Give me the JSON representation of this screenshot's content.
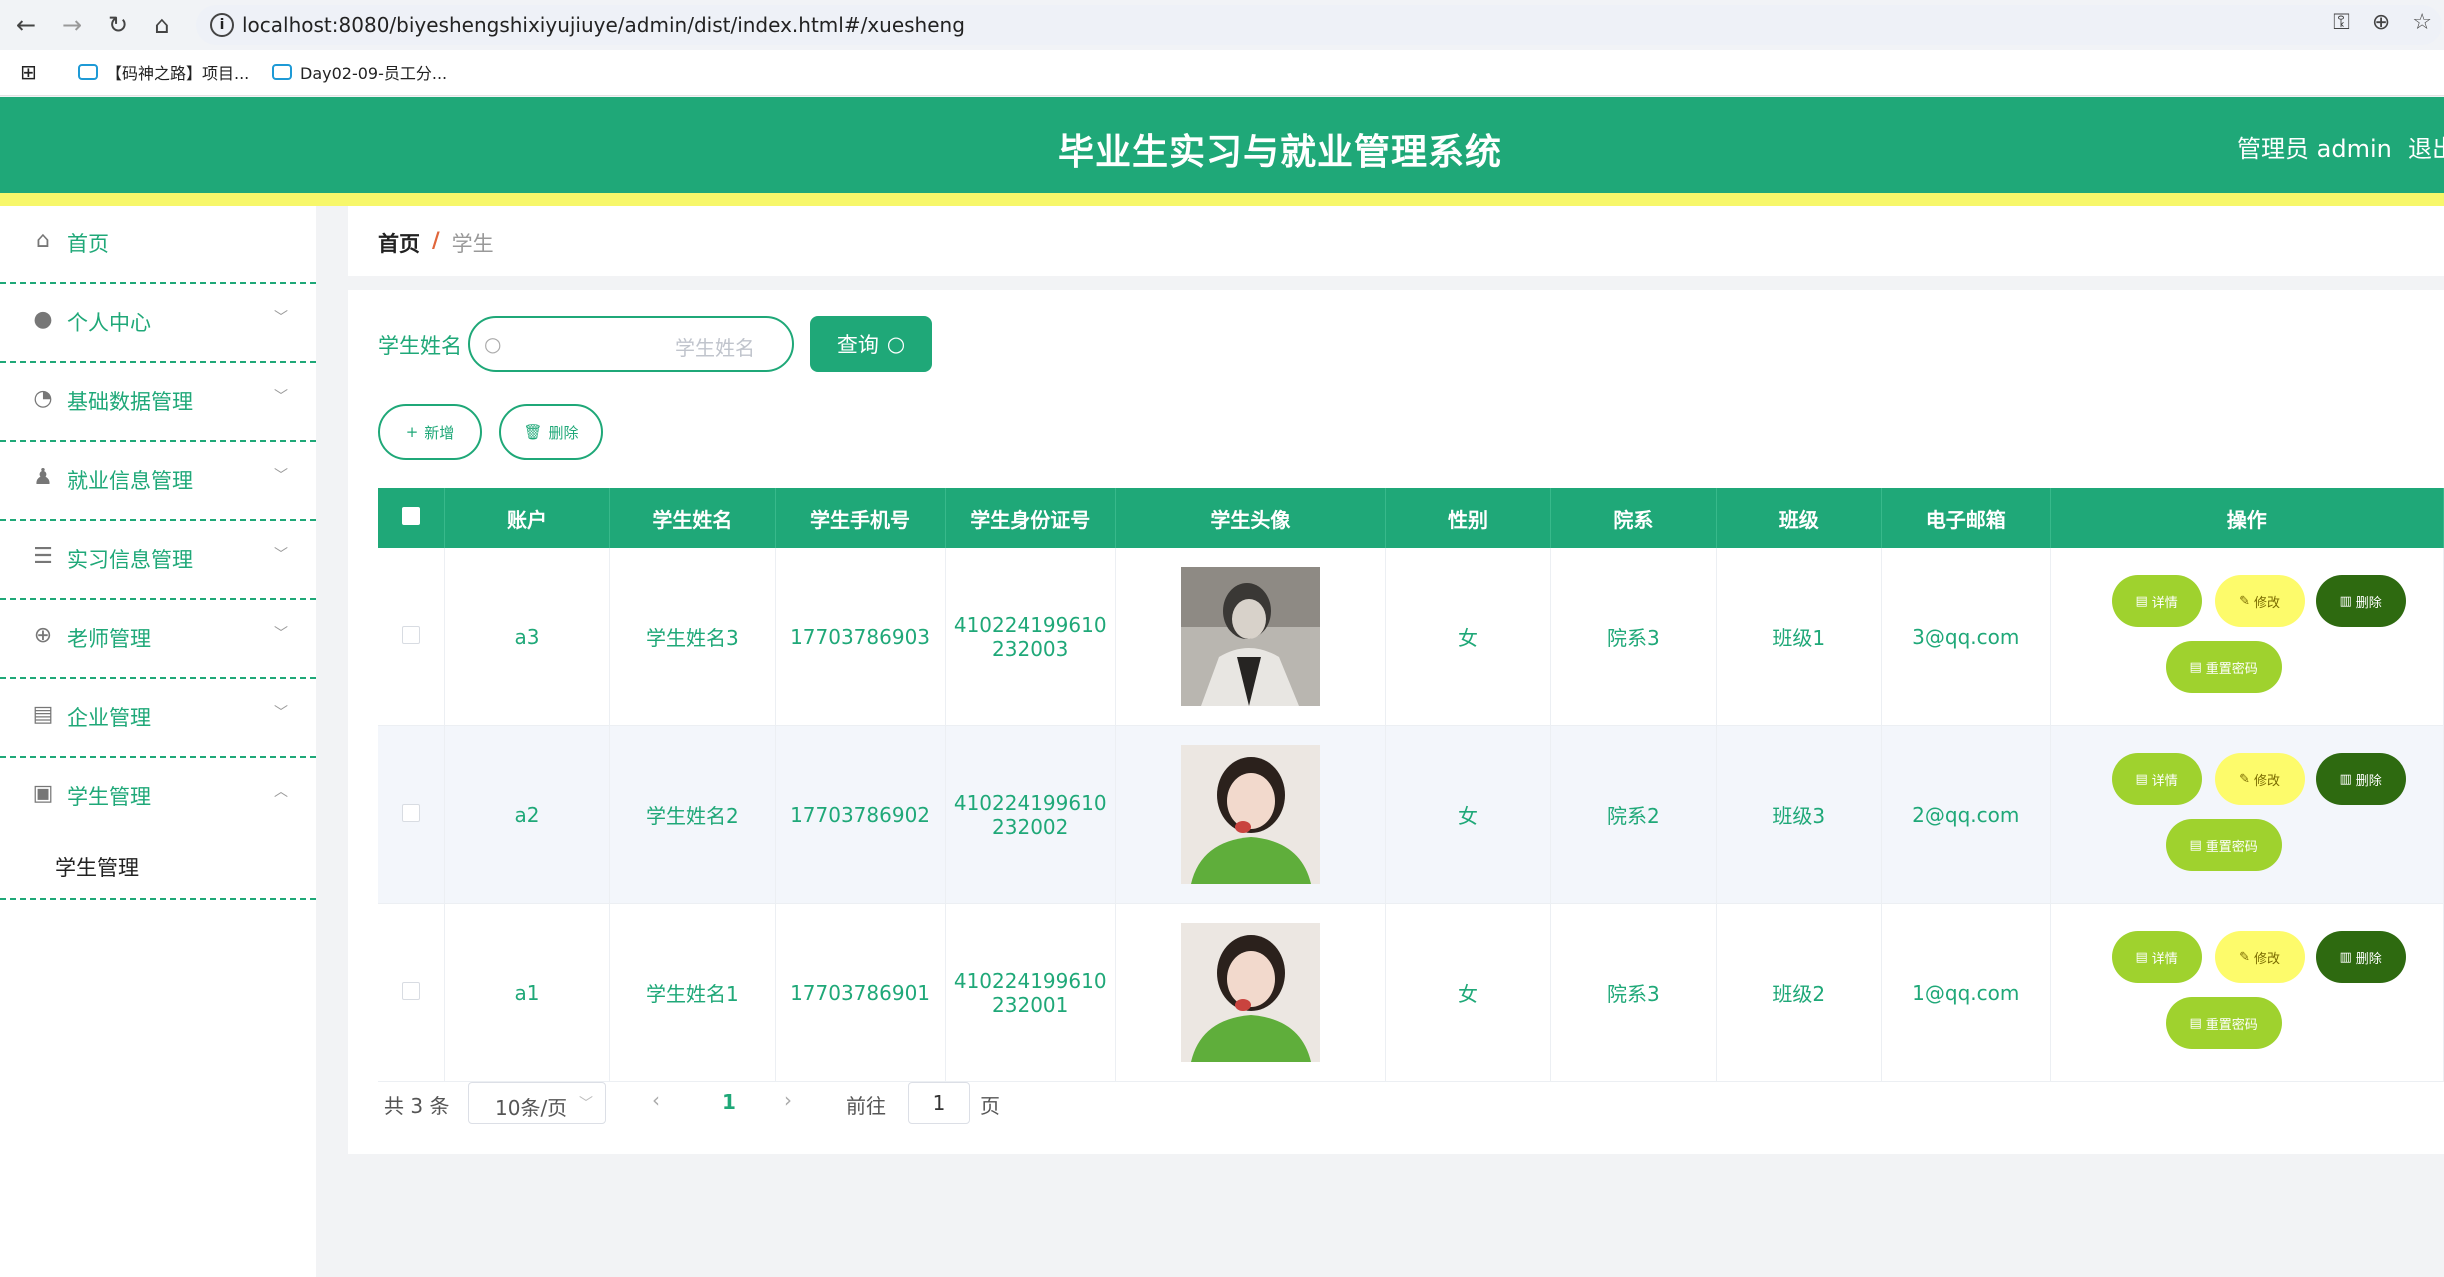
{
  "browser": {
    "url": "localhost:8080/biyeshengshixiyujiuye/admin/dist/index.html#/xuesheng",
    "bookmarks": [
      "【码神之路】项目...",
      "Day02-09-员工分..."
    ]
  },
  "header": {
    "title": "毕业生实习与就业管理系统",
    "user": "管理员 admin",
    "logout": "退出"
  },
  "sidebar": {
    "items": [
      {
        "label": "首页",
        "icon": "home-icon"
      },
      {
        "label": "个人中心",
        "icon": "user-icon"
      },
      {
        "label": "基础数据管理",
        "icon": "gauge-icon"
      },
      {
        "label": "就业信息管理",
        "icon": "stamp-icon"
      },
      {
        "label": "实习信息管理",
        "icon": "sliders-icon"
      },
      {
        "label": "老师管理",
        "icon": "compass-icon"
      },
      {
        "label": "企业管理",
        "icon": "wallet-icon"
      },
      {
        "label": "学生管理",
        "icon": "clipboard-icon"
      }
    ],
    "subitem": "学生管理"
  },
  "breadcrumb": {
    "home": "首页",
    "separator": "/",
    "current": "学生"
  },
  "search": {
    "label": "学生姓名",
    "placeholder": "学生姓名",
    "query_label": "查询"
  },
  "actions": {
    "add_label": "新增",
    "delete_label": "删除"
  },
  "table": {
    "columns": [
      "账户",
      "学生姓名",
      "学生手机号",
      "学生身份证号",
      "学生头像",
      "性别",
      "院系",
      "班级",
      "电子邮箱",
      "操作"
    ],
    "rows": [
      {
        "account": "a3",
        "name": "学生姓名3",
        "phone": "17703786903",
        "id_line1": "410224199610",
        "id_line2": "232003",
        "gender": "女",
        "department": "院系3",
        "class": "班级1",
        "email": "3@qq.com"
      },
      {
        "account": "a2",
        "name": "学生姓名2",
        "phone": "17703786902",
        "id_line1": "410224199610",
        "id_line2": "232002",
        "gender": "女",
        "department": "院系2",
        "class": "班级3",
        "email": "2@qq.com"
      },
      {
        "account": "a1",
        "name": "学生姓名1",
        "phone": "17703786901",
        "id_line1": "410224199610",
        "id_line2": "232001",
        "gender": "女",
        "department": "院系3",
        "class": "班级2",
        "email": "1@qq.com"
      }
    ],
    "ops": {
      "detail": "详情",
      "edit": "修改",
      "delete": "删除",
      "reset": "重置密码"
    }
  },
  "pagination": {
    "total": "共 3 条",
    "page_size": "10条/页",
    "current_page": "1",
    "goto_label": "前往",
    "goto_value": "1",
    "page_unit": "页"
  },
  "colors": {
    "primary": "#1fa878",
    "accent_yellow": "#f7f76a",
    "detail_btn": "#9fd22e",
    "edit_btn": "#fdfb6b",
    "delete_btn": "#2e6a10"
  }
}
